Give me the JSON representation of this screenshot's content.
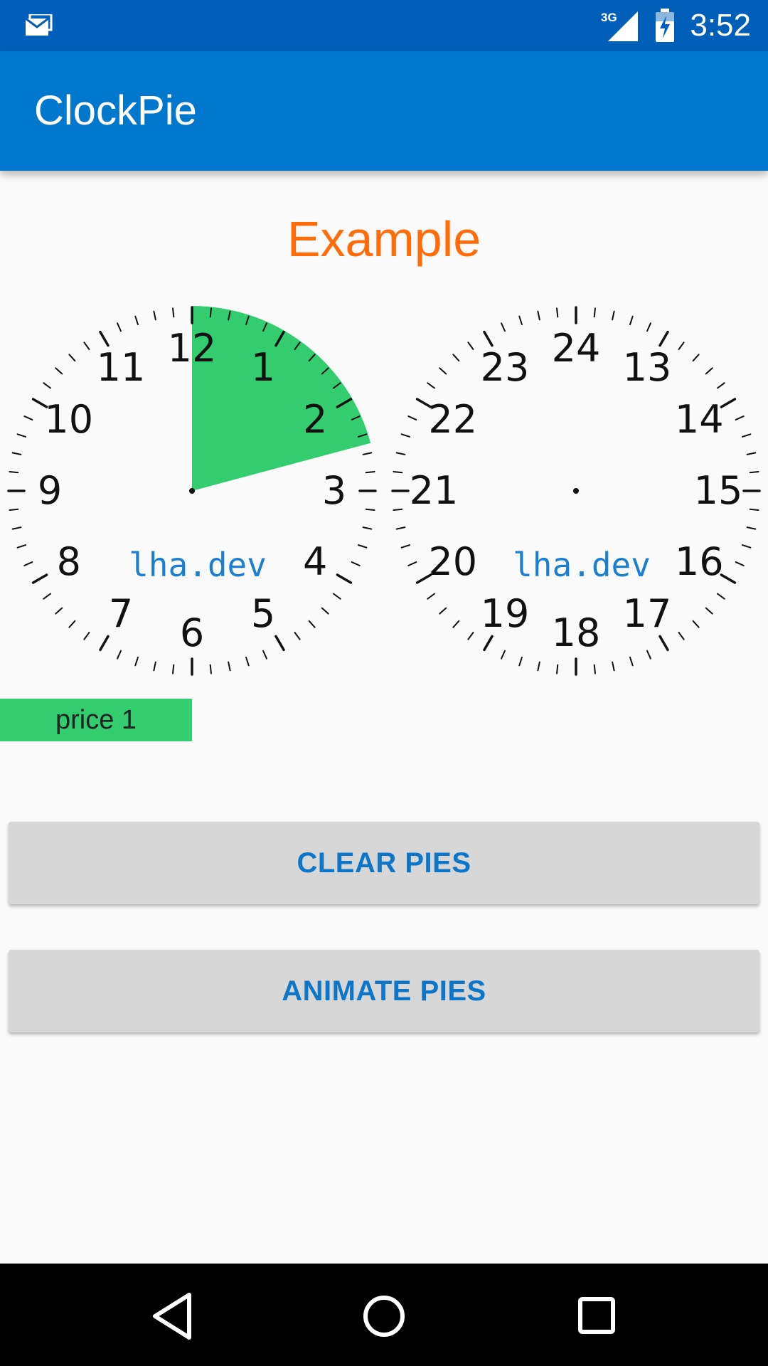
{
  "status_bar": {
    "time": "3:52",
    "network": "3G",
    "icons": [
      "email-notification-icon",
      "cell-signal-icon",
      "battery-charging-icon"
    ]
  },
  "app_bar": {
    "title": "ClockPie"
  },
  "heading": "Example",
  "clocks": [
    {
      "id": "left",
      "labels": [
        "12",
        "1",
        "2",
        "3",
        "4",
        "5",
        "6",
        "7",
        "8",
        "9",
        "10",
        "11"
      ],
      "watermark": "lha.dev",
      "pies": [
        {
          "start_hour": 0,
          "end_hour": 2.5,
          "color": "#33cd6f"
        }
      ]
    },
    {
      "id": "right",
      "labels": [
        "24",
        "13",
        "14",
        "15",
        "16",
        "17",
        "18",
        "19",
        "20",
        "21",
        "22",
        "23"
      ],
      "watermark": "lha.dev",
      "pies": []
    }
  ],
  "legend": [
    {
      "label": "price 1",
      "color": "#33cd6f"
    }
  ],
  "buttons": {
    "clear": "CLEAR PIES",
    "animate": "ANIMATE PIES"
  },
  "colors": {
    "status_bar": "#015fb9",
    "app_bar": "#0177cd",
    "heading": "#ff6d0a",
    "watermark": "#1a7fd1",
    "button_text": "#0d76c9",
    "button_bg": "#d7d7d7"
  },
  "nav_bar": {
    "icons": [
      "back-icon",
      "home-icon",
      "recents-icon"
    ]
  }
}
